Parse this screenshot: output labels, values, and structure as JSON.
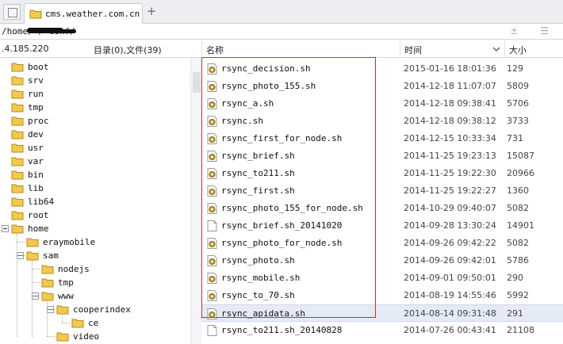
{
  "tab": {
    "title": "cms.weather.com.cn",
    "add_label": "+"
  },
  "path": {
    "text": "/home/      /      conf/",
    "tools": "± ☰"
  },
  "header": {
    "address": ".4.185.220",
    "summary": "目录(0),文件(39)",
    "col_name": "名称",
    "col_time": "时间",
    "col_size": "大小"
  },
  "tree": [
    {
      "label": "boot"
    },
    {
      "label": "srv"
    },
    {
      "label": "run"
    },
    {
      "label": "tmp"
    },
    {
      "label": "proc"
    },
    {
      "label": "dev"
    },
    {
      "label": "usr"
    },
    {
      "label": "var"
    },
    {
      "label": "bin"
    },
    {
      "label": "lib"
    },
    {
      "label": "lib64"
    },
    {
      "label": "root"
    },
    {
      "label": "home"
    },
    {
      "label": "eraymobile"
    },
    {
      "label": "sam"
    },
    {
      "label": "nodejs"
    },
    {
      "label": "tmp"
    },
    {
      "label": "www"
    },
    {
      "label": "cooperindex"
    },
    {
      "label": "ce"
    },
    {
      "label": "video"
    }
  ],
  "files": [
    {
      "name": "rsync_decision.sh",
      "time": "2015-01-16 18:01:36",
      "size": "129",
      "icon": "script-file-icon"
    },
    {
      "name": "rsync_photo_155.sh",
      "time": "2014-12-18 11:07:07",
      "size": "5809",
      "icon": "script-file-icon"
    },
    {
      "name": "rsync_a.sh",
      "time": "2014-12-18 09:38:41",
      "size": "5706",
      "icon": "script-file-icon"
    },
    {
      "name": "rsync.sh",
      "time": "2014-12-18 09:38:12",
      "size": "3733",
      "icon": "script-file-icon"
    },
    {
      "name": "rsync_first_for_node.sh",
      "time": "2014-12-15 10:33:34",
      "size": "731",
      "icon": "script-file-icon"
    },
    {
      "name": "rsync_brief.sh",
      "time": "2014-11-25 19:23:13",
      "size": "15087",
      "icon": "script-file-icon"
    },
    {
      "name": "rsync_to211.sh",
      "time": "2014-11-25 19:22:30",
      "size": "20966",
      "icon": "script-file-icon"
    },
    {
      "name": "rsync_first.sh",
      "time": "2014-11-25 19:22:27",
      "size": "1360",
      "icon": "script-file-icon"
    },
    {
      "name": "rsync_photo_155_for_node.sh",
      "time": "2014-10-29 09:40:07",
      "size": "5082",
      "icon": "script-file-icon"
    },
    {
      "name": "rsync_brief.sh_20141020",
      "time": "2014-09-28 13:30:24",
      "size": "14901",
      "icon": "blank-file-icon"
    },
    {
      "name": "rsync_photo_for_node.sh",
      "time": "2014-09-26 09:42:22",
      "size": "5082",
      "icon": "script-file-icon"
    },
    {
      "name": "rsync_photo.sh",
      "time": "2014-09-26 09:42:01",
      "size": "5786",
      "icon": "script-file-icon"
    },
    {
      "name": "rsync_mobile.sh",
      "time": "2014-09-01 09:50:01",
      "size": "290",
      "icon": "script-file-icon"
    },
    {
      "name": "rsync_to_70.sh",
      "time": "2014-08-19 14:55:46",
      "size": "5992",
      "icon": "script-file-icon"
    },
    {
      "name": "rsync_apidata.sh",
      "time": "2014-08-14 09:31:48",
      "size": "291",
      "icon": "script-file-icon"
    },
    {
      "name": "rsync_to211.sh_20140828",
      "time": "2014-07-26 00:43:41",
      "size": "21108",
      "icon": "blank-file-icon"
    }
  ],
  "colors": {
    "highlight": "#e0282a",
    "selected_row": "#e5eaf7",
    "folder": "#f2c94c"
  }
}
